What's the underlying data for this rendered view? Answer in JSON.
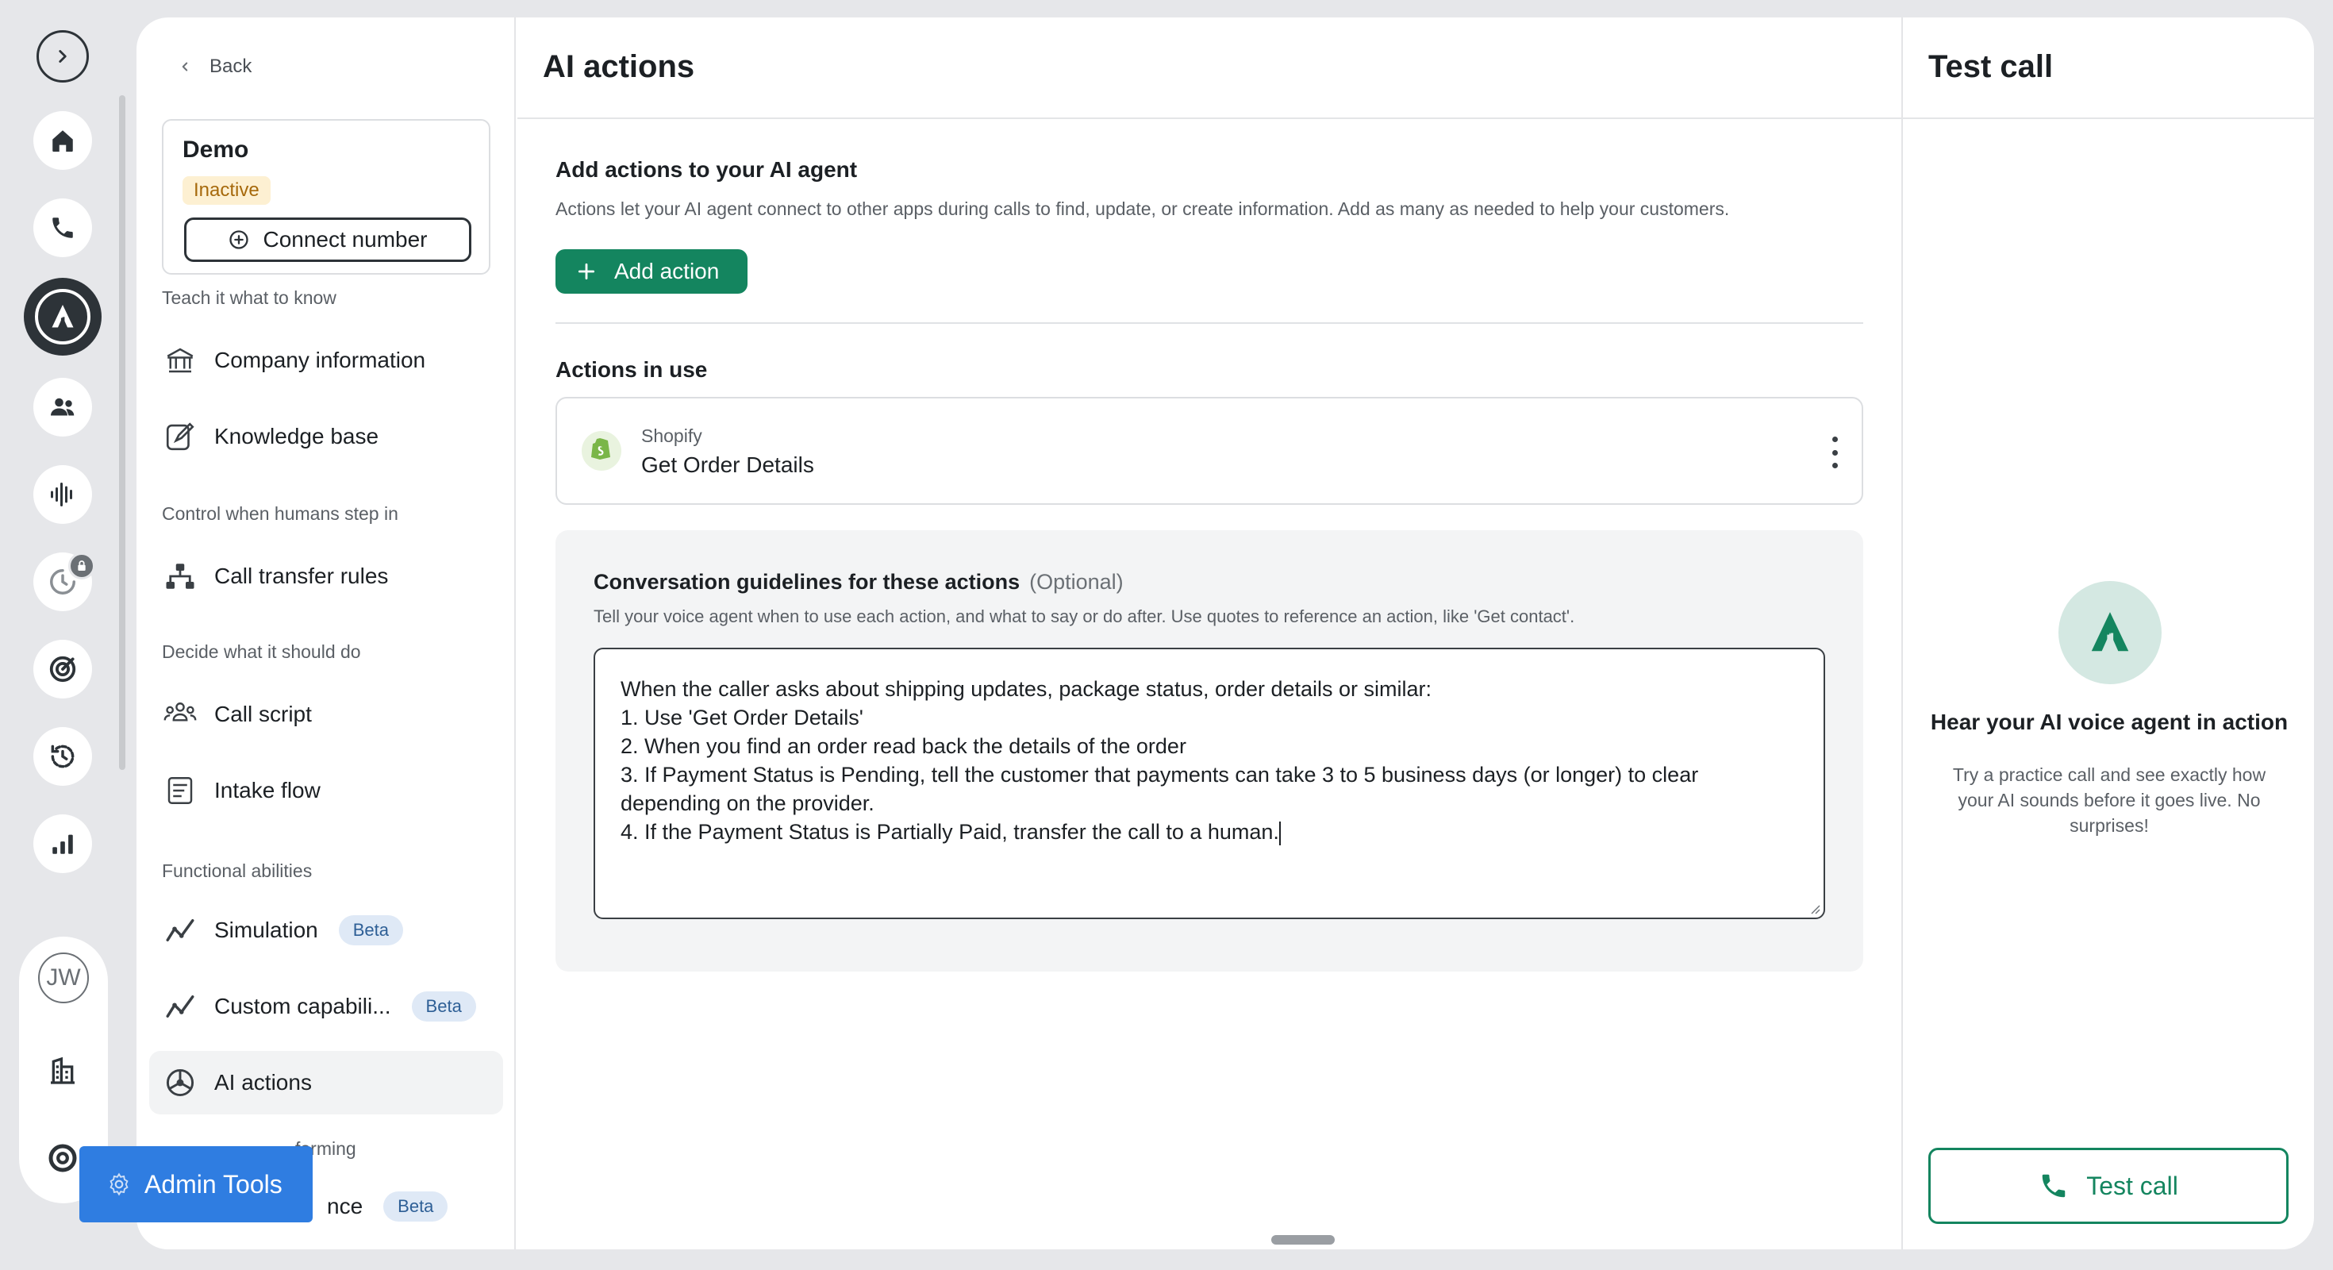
{
  "rail": {
    "avatar_initials": "JW"
  },
  "sidebar": {
    "back_label": "Back",
    "agent": {
      "name": "Demo",
      "status": "Inactive",
      "connect_label": "Connect number"
    },
    "sections": {
      "know": "Teach it what to know",
      "humans": "Control when humans step in",
      "decide": "Decide what it should do",
      "functional": "Functional abilities",
      "performing": "forming"
    },
    "items": {
      "company": "Company information",
      "knowledge": "Knowledge base",
      "transfer": "Call transfer rules",
      "script": "Call script",
      "intake": "Intake flow",
      "simulation": "Simulation",
      "custom": "Custom capabili...",
      "ai_actions": "AI actions",
      "partial": "nce"
    },
    "beta_label": "Beta"
  },
  "admin_tools_label": "Admin Tools",
  "main": {
    "title": "AI actions",
    "add_heading": "Add actions to your AI agent",
    "add_description": "Actions let your AI agent connect to other apps during calls to find, update, or create information. Add as many as needed to help your customers.",
    "add_button": "Add action",
    "in_use_heading": "Actions in use",
    "action": {
      "provider": "Shopify",
      "name": "Get Order Details"
    },
    "guidelines": {
      "title": "Conversation guidelines for these actions",
      "optional": "(Optional)",
      "description": "Tell your voice agent when to use each action, and what to say or do after. Use quotes to reference an action, like 'Get contact'.",
      "lines": [
        "When the caller asks about shipping updates, package status, order details or similar:",
        "1. Use 'Get Order Details'",
        "2. When you find an order read back the details of the order",
        "3. If Payment Status is Pending, tell the customer that payments can take 3 to 5 business days (or longer) to clear",
        "depending on the provider.",
        "4. If the Payment Status is Partially Paid, transfer the call to a human."
      ]
    }
  },
  "test_panel": {
    "title": "Test call",
    "hear_title": "Hear your AI voice agent in action",
    "hear_description": "Try a practice call and see exactly how your AI sounds before it goes live. No surprises!",
    "button": "Test call"
  },
  "colors": {
    "accent_green": "#14855f",
    "admin_blue": "#2f7de1",
    "rail_active": "#2d3338",
    "inactive_badge_bg": "#fdf0d2",
    "beta_bg": "#dfe9f6"
  },
  "icons": {
    "rail": [
      "expand-icon",
      "home-icon",
      "phone-icon",
      "ai-agent-icon",
      "contacts-icon",
      "voice-wave-icon",
      "clock-locked-icon",
      "target-icon",
      "history-icon",
      "analytics-icon",
      "building-icon",
      "support-icon"
    ],
    "sidebar": [
      "bank-icon",
      "edit-doc-icon",
      "org-chart-icon",
      "people-icon",
      "form-icon",
      "trend-icon",
      "trend-icon",
      "ai-actions-icon"
    ]
  }
}
